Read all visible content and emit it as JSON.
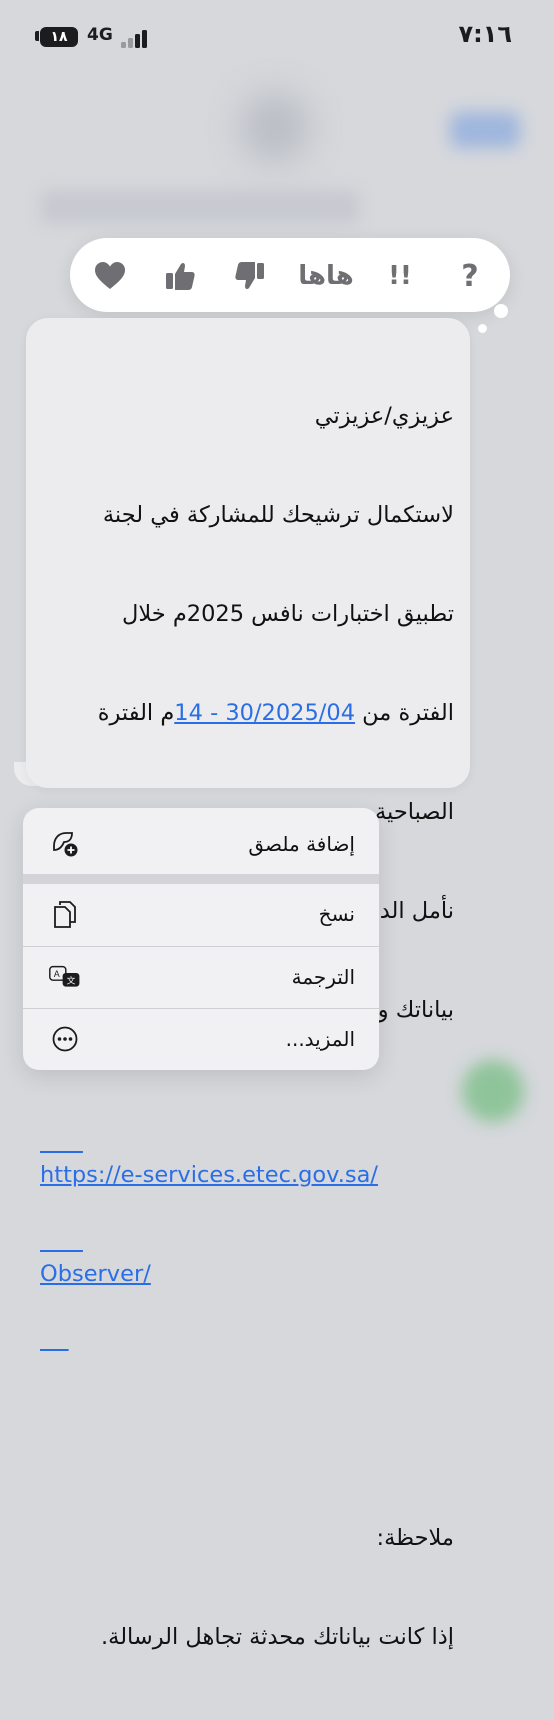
{
  "status_bar": {
    "battery": "١٨",
    "network": "4G",
    "time": "٧:١٦"
  },
  "reactions": {
    "items": [
      {
        "name": "heart-icon"
      },
      {
        "name": "thumbs-up-icon"
      },
      {
        "name": "thumbs-down-icon"
      },
      {
        "name": "haha",
        "label": "هاها"
      },
      {
        "name": "exclamation-icon",
        "label": "!!"
      },
      {
        "name": "question-icon",
        "label": "?"
      }
    ]
  },
  "message": {
    "lines": [
      "عزيزي/عزيزتي",
      "لاستكمال ترشيحك للمشاركة في لجنة",
      "تطبيق اختبارات نافس 2025م خلال",
      "الصباحية."
    ],
    "period_prefix": "الفترة من ",
    "period_link": "14 - 30/2025/04",
    "period_suffix": "م الفترة",
    "request_line1": "نأمل الدخول على الرابط وتحديث جميع",
    "request_line2": "بياناتك ورفع المستندات المطلوبة.",
    "url_line1": "https://e-services.etec.gov.sa/",
    "url_line2": "Observer/",
    "note_label": "ملاحظة:",
    "note_text": "إذا كانت بياناتك محدثة تجاهل الرسالة."
  },
  "menu": {
    "items": [
      {
        "label": "إضافة ملصق",
        "icon": "add-sticker-icon"
      },
      {
        "label": "نسخ",
        "icon": "copy-icon"
      },
      {
        "label": "الترجمة",
        "icon": "translate-icon"
      },
      {
        "label": "المزيد...",
        "icon": "more-icon"
      }
    ]
  }
}
